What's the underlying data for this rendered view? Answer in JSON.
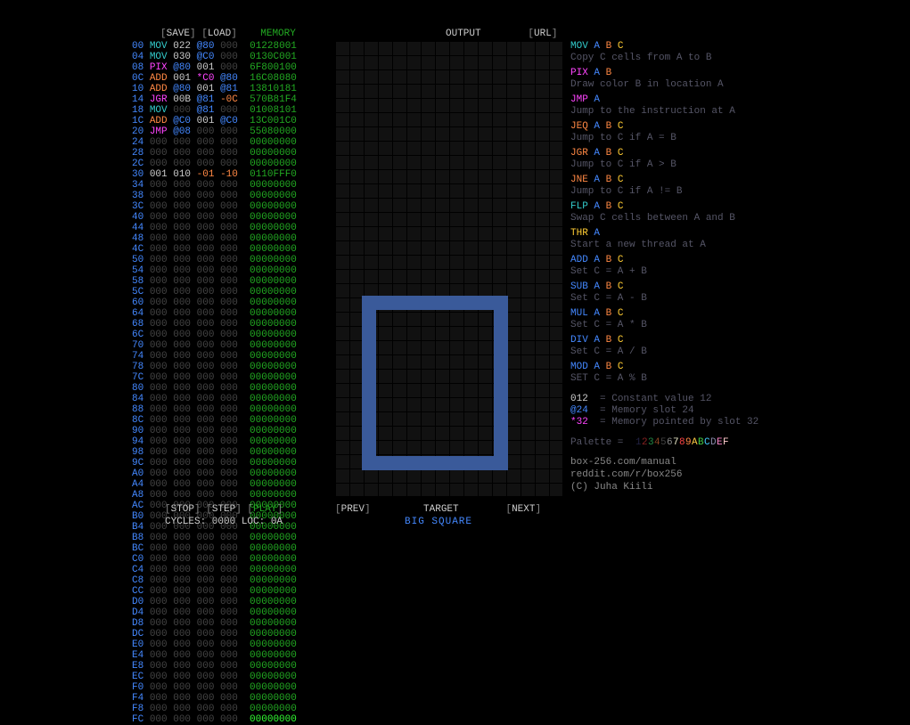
{
  "buttons": {
    "save": "SAVE",
    "load": "LOAD",
    "memory": "MEMORY",
    "output": "OUTPUT",
    "url": "URL",
    "stop": "STOP",
    "step": "STEP",
    "play": "PLAY",
    "prev": "PREV",
    "target": "TARGET",
    "next": "NEXT"
  },
  "status": {
    "cycles": "CYCLES: 0000 LOC: 0A",
    "target_name": "BIG SQUARE"
  },
  "code_rows": [
    {
      "a": "00",
      "op": "MOV",
      "o1": "022",
      "o2": "@80",
      "o3": "000",
      "m": "01228001",
      "opc": "t"
    },
    {
      "a": "04",
      "op": "MOV",
      "o1": "030",
      "o2": "@C0",
      "o3": "000",
      "m": "0130C001",
      "opc": "t"
    },
    {
      "a": "08",
      "op": "PIX",
      "o1": "@80",
      "o2": "001",
      "o3": "000",
      "m": "6F800100",
      "opc": "p"
    },
    {
      "a": "0C",
      "op": "ADD",
      "o1": "001",
      "o2": "*C0",
      "o3": "@80",
      "m": "16C08080",
      "opc": "o"
    },
    {
      "a": "10",
      "op": "ADD",
      "o1": "@80",
      "o2": "001",
      "o3": "@81",
      "m": "13810181",
      "opc": "o"
    },
    {
      "a": "14",
      "op": "JGR",
      "o1": "00B",
      "o2": "@81",
      "o3": "-0C",
      "m": "570B81F4",
      "opc": "p"
    },
    {
      "a": "18",
      "op": "MOV",
      "o1": "000",
      "o2": "@81",
      "o3": "000",
      "m": "01008101",
      "opc": "t"
    },
    {
      "a": "1C",
      "op": "ADD",
      "o1": "@C0",
      "o2": "001",
      "o3": "@C0",
      "m": "13C001C0",
      "opc": "o"
    },
    {
      "a": "20",
      "op": "JMP",
      "o1": "@08",
      "o2": "000",
      "o3": "000",
      "m": "55080000",
      "opc": "p"
    },
    {
      "a": "24",
      "op": "000",
      "o1": "000",
      "o2": "000",
      "o3": "000",
      "m": "00000000",
      "opc": "dg"
    },
    {
      "a": "28",
      "op": "000",
      "o1": "000",
      "o2": "000",
      "o3": "000",
      "m": "00000000",
      "opc": "dg"
    },
    {
      "a": "2C",
      "op": "000",
      "o1": "000",
      "o2": "000",
      "o3": "000",
      "m": "00000000",
      "opc": "dg"
    },
    {
      "a": "30",
      "op": "001",
      "o1": "010",
      "o2": "-01",
      "o3": "-10",
      "m": "0110FFF0",
      "opc": "w"
    },
    {
      "a": "34",
      "op": "000",
      "o1": "000",
      "o2": "000",
      "o3": "000",
      "m": "00000000",
      "opc": "dg"
    }
  ],
  "zero_rows": [
    "38",
    "3C",
    "40",
    "44",
    "48",
    "4C",
    "50",
    "54",
    "58",
    "5C",
    "60",
    "64",
    "68",
    "6C",
    "70",
    "74",
    "78",
    "7C",
    "80",
    "84",
    "88",
    "8C",
    "90",
    "94",
    "98",
    "9C",
    "A0",
    "A4",
    "A8",
    "AC",
    "B0",
    "B4",
    "B8",
    "BC",
    "C0",
    "C4",
    "C8",
    "CC",
    "D0",
    "D4",
    "D8",
    "DC",
    "E0",
    "E4",
    "E8",
    "EC",
    "F0",
    "F4",
    "F8",
    "FC"
  ],
  "ref": [
    {
      "op": "MOV",
      "args": "A B C",
      "desc": "Copy C cells from A to B",
      "c": "t"
    },
    {
      "op": "PIX",
      "args": "A B",
      "desc": "Draw color B in location A",
      "c": "p"
    },
    {
      "op": "JMP",
      "args": "A",
      "desc": "Jump to the instruction at A",
      "c": "p"
    },
    {
      "op": "JEQ",
      "args": "A B C",
      "desc": "Jump to C if A = B",
      "c": "o"
    },
    {
      "op": "JGR",
      "args": "A B C",
      "desc": "Jump to C if A > B",
      "c": "o"
    },
    {
      "op": "JNE",
      "args": "A B C",
      "desc": "Jump to C if A != B",
      "c": "o"
    },
    {
      "op": "FLP",
      "args": "A B C",
      "desc": "Swap C cells between A and B",
      "c": "t"
    },
    {
      "op": "THR",
      "args": "A",
      "desc": "Start a new thread at A",
      "c": "y"
    },
    {
      "op": "ADD",
      "args": "A B C",
      "desc": "Set C = A + B",
      "c": "b"
    },
    {
      "op": "SUB",
      "args": "A B C",
      "desc": "Set C = A - B",
      "c": "b"
    },
    {
      "op": "MUL",
      "args": "A B C",
      "desc": "Set C = A * B",
      "c": "b"
    },
    {
      "op": "DIV",
      "args": "A B C",
      "desc": "Set C = A / B",
      "c": "b"
    },
    {
      "op": "MOD",
      "args": "A B C",
      "desc": "SET C = A % B",
      "c": "b"
    }
  ],
  "legend": {
    "const": {
      "k": "012",
      "d": "= Constant value 12"
    },
    "mem": {
      "k": "@24",
      "d": "= Memory slot 24"
    },
    "ptr": {
      "k": "*32",
      "d": "= Memory pointed by slot 32"
    }
  },
  "palette_label": "Palette = ",
  "palette": [
    "0",
    "1",
    "2",
    "3",
    "4",
    "5",
    "6",
    "7",
    "8",
    "9",
    "A",
    "B",
    "C",
    "D",
    "E",
    "F"
  ],
  "palette_colors": [
    "#000",
    "#224",
    "#822",
    "#284",
    "#842",
    "#444",
    "#888",
    "#eec",
    "#f44",
    "#f84",
    "#fc4",
    "#4c4",
    "#4cf",
    "#88a",
    "#f8c",
    "#fcc"
  ],
  "links": {
    "manual": "box-256.com/manual",
    "reddit": "reddit.com/r/box256",
    "credit": "(C) Juha Kiili"
  }
}
